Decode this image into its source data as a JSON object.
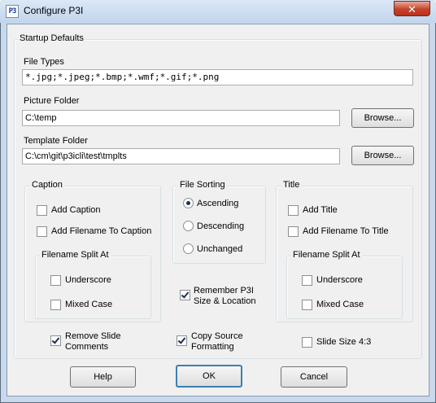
{
  "window": {
    "icon_text": "P3",
    "title": "Configure P3I",
    "close_glyph": "✕"
  },
  "startup": {
    "group_label": "Startup Defaults",
    "file_types_label": "File Types",
    "file_types_value": "*.jpg;*.jpeg;*.bmp;*.wmf;*.gif;*.png",
    "picture_folder_label": "Picture Folder",
    "picture_folder_value": "C:\\temp",
    "template_folder_label": "Template Folder",
    "template_folder_value": "C:\\cm\\git\\p3icli\\test\\tmplts",
    "browse_label": "Browse..."
  },
  "caption": {
    "group_label": "Caption",
    "add_caption": {
      "label": "Add Caption",
      "checked": false
    },
    "add_filename": {
      "label": "Add Filename To Caption",
      "checked": false
    },
    "split_group_label": "Filename Split At",
    "underscore": {
      "label": "Underscore",
      "checked": false
    },
    "mixed_case": {
      "label": "Mixed Case",
      "checked": false
    }
  },
  "sorting": {
    "group_label": "File Sorting",
    "options": [
      {
        "label": "Ascending",
        "selected": true
      },
      {
        "label": "Descending",
        "selected": false
      },
      {
        "label": "Unchanged",
        "selected": false
      }
    ]
  },
  "title": {
    "group_label": "Title",
    "add_title": {
      "label": "Add Title",
      "checked": false
    },
    "add_filename": {
      "label": "Add Filename To Title",
      "checked": false
    },
    "split_group_label": "Filename Split At",
    "underscore": {
      "label": "Underscore",
      "checked": false
    },
    "mixed_case": {
      "label": "Mixed Case",
      "checked": false
    }
  },
  "misc": {
    "remember_line1": "Remember  P3I",
    "remember_line2": "Size & Location",
    "remember_checked": true,
    "remove_comments_line1": "Remove Slide",
    "remove_comments_line2": "Comments",
    "remove_comments_checked": true,
    "copy_source_line1": "Copy Source",
    "copy_source_line2": "Formatting",
    "copy_source_checked": true,
    "slide_size_label": "Slide Size 4:3",
    "slide_size_checked": false
  },
  "buttons": {
    "help": "Help",
    "ok": "OK",
    "cancel": "Cancel"
  }
}
